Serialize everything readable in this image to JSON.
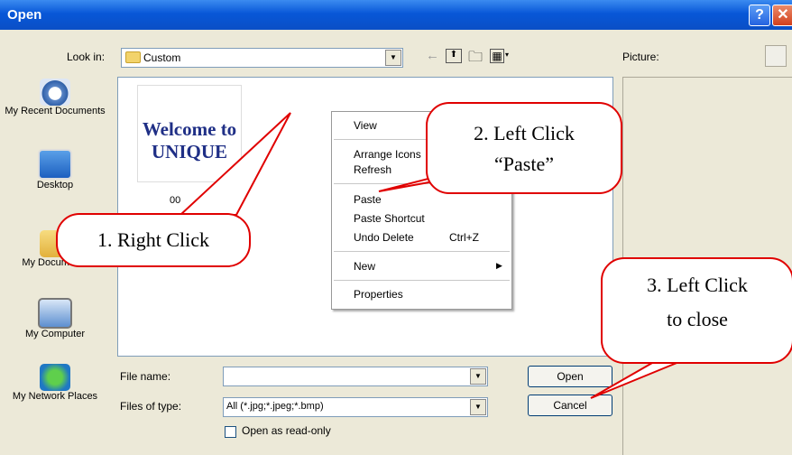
{
  "window": {
    "title": "Open"
  },
  "toolbar": {
    "look_in_label": "Look in:",
    "look_in_value": "Custom",
    "picture_label": "Picture:"
  },
  "places": [
    {
      "label": "My Recent Documents",
      "icon": "recent-documents-icon"
    },
    {
      "label": "Desktop",
      "icon": "desktop-icon"
    },
    {
      "label": "My Documents",
      "icon": "my-documents-icon"
    },
    {
      "label": "My Computer",
      "icon": "my-computer-icon"
    },
    {
      "label": "My Network Places",
      "icon": "network-places-icon"
    }
  ],
  "thumbnail": {
    "line1": "Welcome to",
    "line2": "UNIQUE",
    "name": "00"
  },
  "context_menu": {
    "items": [
      "View",
      "Arrange Icons",
      "Refresh",
      "Paste",
      "Paste Shortcut",
      "Undo Delete",
      "New",
      "Properties"
    ],
    "undo_shortcut": "Ctrl+Z"
  },
  "form": {
    "file_name_label": "File name:",
    "file_name_value": "",
    "file_type_label": "Files of type:",
    "file_type_value": "All (*.jpg;*.jpeg;*.bmp)",
    "read_only_label": "Open as read-only",
    "open_button": "Open",
    "cancel_button": "Cancel"
  },
  "callouts": {
    "right_click": "1. Right Click",
    "paste_line1": "2. Left Click",
    "paste_line2": "“Paste”",
    "close_line1": "3. Left Click",
    "close_line2": "to close"
  },
  "colors": {
    "title_bar": "#0a52cc",
    "callout_border": "#e00000",
    "thumbnail_text": "#1f2f86"
  }
}
